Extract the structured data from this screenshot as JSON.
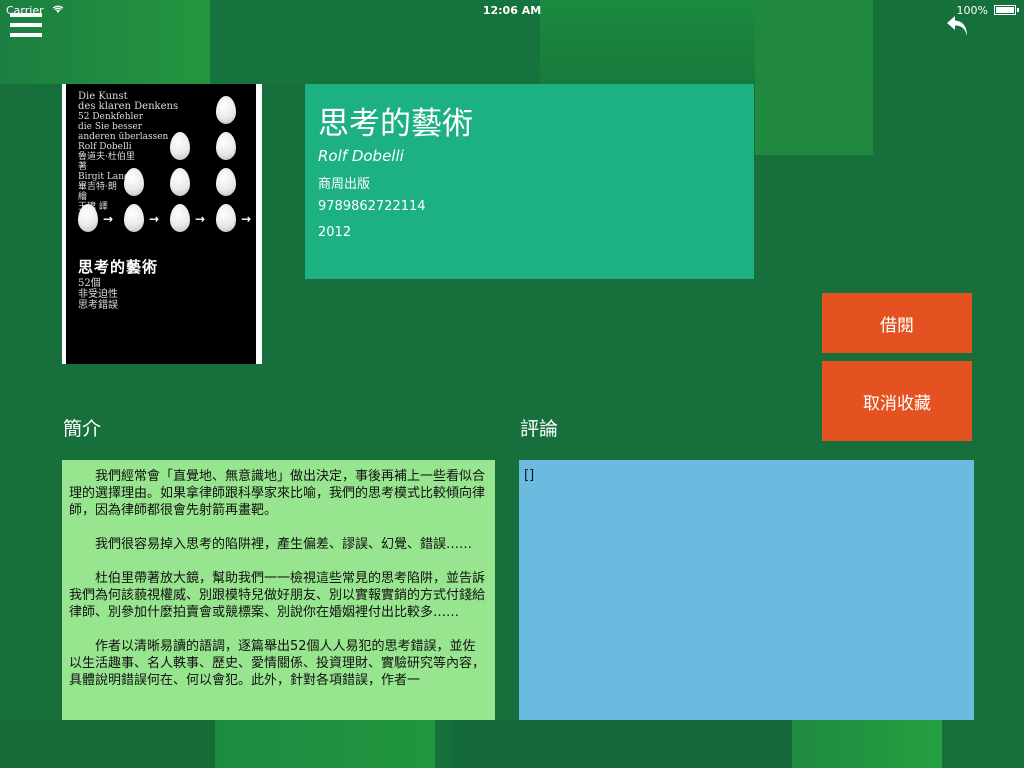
{
  "status_bar": {
    "carrier": "Carrier",
    "time": "12:06 AM",
    "battery": "100%"
  },
  "book": {
    "title": "思考的藝術",
    "author": "Rolf Dobelli",
    "publisher": "商周出版",
    "isbn": "9789862722114",
    "year": "2012"
  },
  "cover": {
    "small_text": [
      "Die Kunst",
      "des klaren Denkens",
      "52 Denkfehler",
      "die Sie besser",
      "anderen überlassen",
      "Rolf Dobelli",
      "魯道夫·杜伯里",
      "著",
      "Birgit Lang",
      "畢吉特·朗",
      "繪",
      "王瑋 譯"
    ],
    "title": "思考的藝術",
    "subtitle_lines": [
      "52個",
      "非受迫性",
      "思考錯誤"
    ]
  },
  "buttons": {
    "borrow": "借閱",
    "unfavorite": "取消收藏"
  },
  "sections": {
    "intro_heading": "簡介",
    "review_heading": "評論"
  },
  "intro_paragraphs": [
    "我們經常會「直覺地、無意識地」做出決定，事後再補上一些看似合理的選擇理由。如果拿律師跟科學家來比喻，我們的思考模式比較傾向律師，因為律師都很會先射箭再畫靶。",
    "我們很容易掉入思考的陷阱裡，產生偏差、謬誤、幻覺、錯誤……",
    "杜伯里帶著放大鏡，幫助我們一一檢視這些常見的思考陷阱，並告訴我們為何該藐視權威、別跟模特兒做好朋友、別以實報實銷的方式付錢給律師、別參加什麼拍賣會或競標案、別說你在婚姻裡付出比較多……",
    "作者以清晰易讀的語調，逐篇舉出52個人人易犯的思考錯誤，並佐以生活趣事、名人軼事、歷史、愛情關係、投資理財、實驗研究等內容，具體說明錯誤何在、何以會犯。此外，針對各項錯誤，作者一"
  ],
  "review_text": "[]",
  "icons": {
    "menu": "hamburger-menu-icon",
    "back": "reply-arrow-icon"
  },
  "colors": {
    "background": "#17703c",
    "info_panel": "#1db083",
    "button": "#e45222",
    "intro_box": "#98e58f",
    "review_box": "#6bbbe0"
  }
}
